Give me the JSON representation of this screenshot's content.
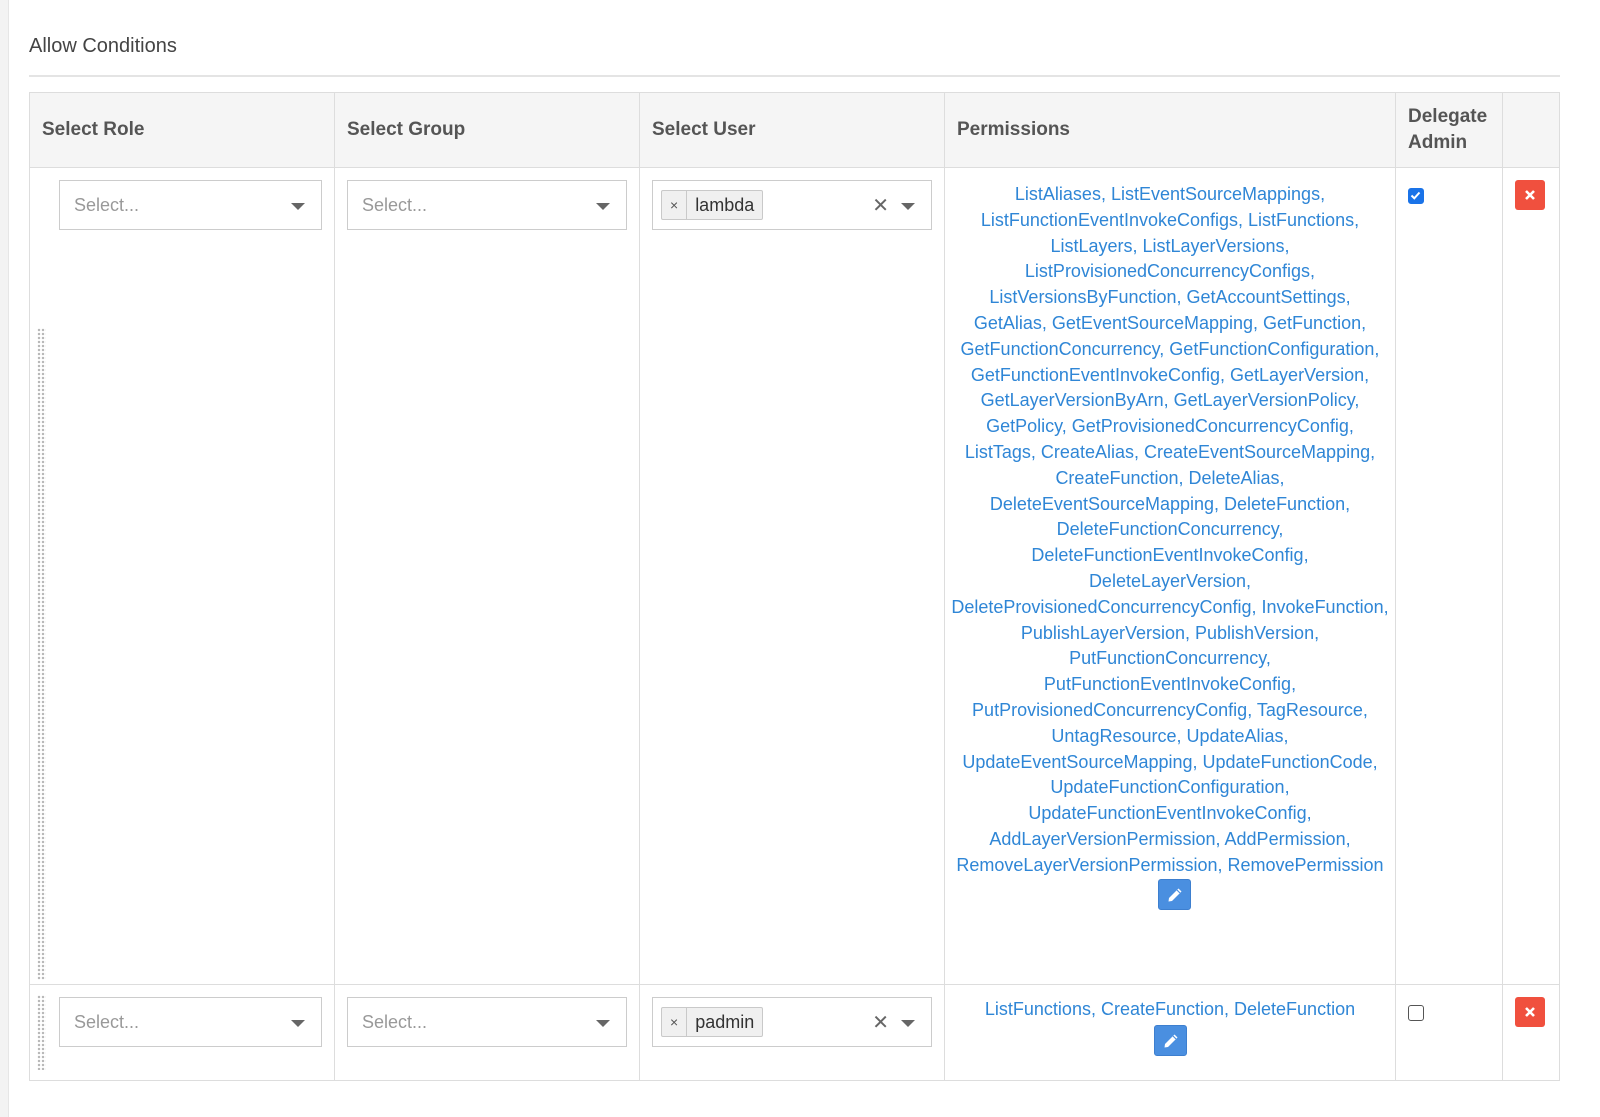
{
  "section": {
    "title": "Allow Conditions"
  },
  "table": {
    "headers": {
      "role": "Select Role",
      "group": "Select Group",
      "user": "Select User",
      "permissions": "Permissions",
      "delegate_line1": "Delegate",
      "delegate_line2": "Admin"
    },
    "rows": [
      {
        "role_placeholder": "Select...",
        "group_placeholder": "Select...",
        "user_tag": "lambda",
        "permissions": "ListAliases, ListEventSourceMappings, ListFunctionEventInvokeConfigs, ListFunctions, ListLayers, ListLayerVersions, ListProvisionedConcurrencyConfigs, ListVersionsByFunction, GetAccountSettings, GetAlias, GetEventSourceMapping, GetFunction, GetFunctionConcurrency, GetFunctionConfiguration, GetFunctionEventInvokeConfig, GetLayerVersion, GetLayerVersionByArn, GetLayerVersionPolicy, GetPolicy, GetProvisionedConcurrencyConfig, ListTags, CreateAlias, CreateEventSourceMapping, CreateFunction, DeleteAlias, DeleteEventSourceMapping, DeleteFunction, DeleteFunctionConcurrency, DeleteFunctionEventInvokeConfig, DeleteLayerVersion, DeleteProvisionedConcurrencyConfig, InvokeFunction, PublishLayerVersion, PublishVersion, PutFunctionConcurrency, PutFunctionEventInvokeConfig, PutProvisionedConcurrencyConfig, TagResource, UntagResource, UpdateAlias, UpdateEventSourceMapping, UpdateFunctionCode, UpdateFunctionConfiguration, UpdateFunctionEventInvokeConfig, AddLayerVersionPermission, AddPermission, RemoveLayerVersionPermission, RemovePermission",
        "delegate_admin": true
      },
      {
        "role_placeholder": "Select...",
        "group_placeholder": "Select...",
        "user_tag": "padmin",
        "permissions": "ListFunctions, CreateFunction, DeleteFunction",
        "delegate_admin": false
      }
    ]
  },
  "icons": {
    "edit": "pencil-icon",
    "delete": "times-icon",
    "clear": "clear-icon",
    "dropdown": "caret-down-icon",
    "drag": "drag-handle-icon"
  },
  "colors": {
    "permission_link": "#2f86d6",
    "edit_button": "#4a8fe0",
    "delete_button": "#f0503e",
    "checkbox_checked": "#1a73e8"
  }
}
